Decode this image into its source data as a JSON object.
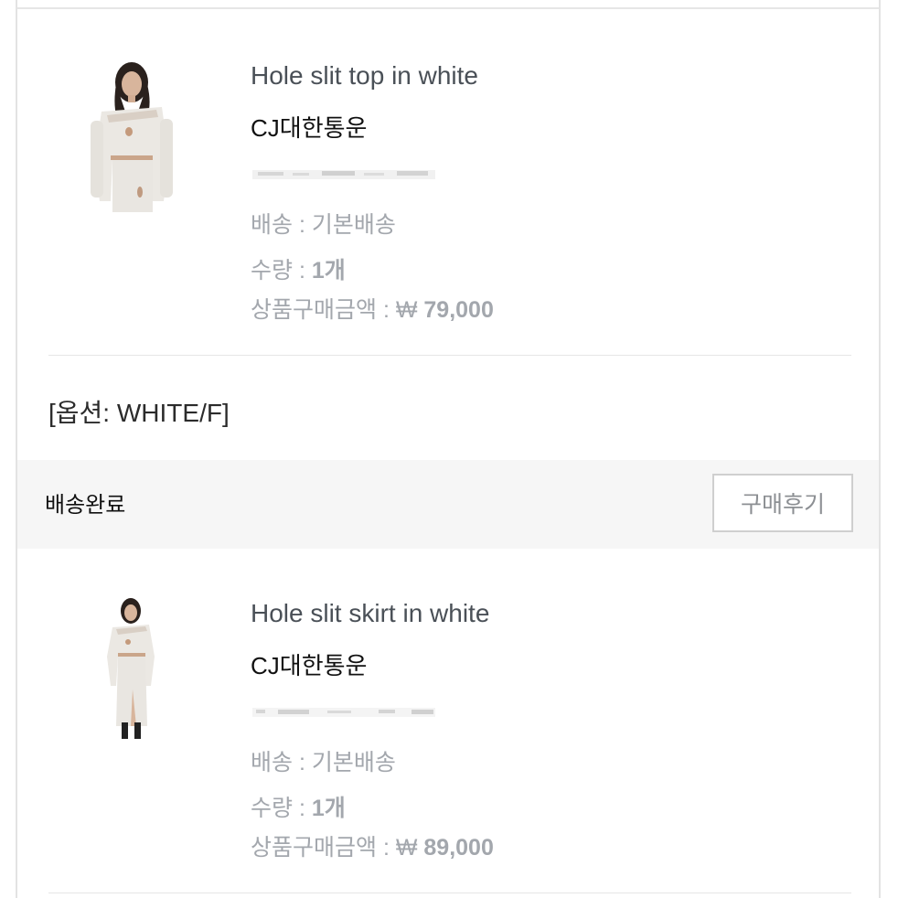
{
  "orders": [
    {
      "product_name": "Hole slit top in white",
      "carrier": "CJ대한통운",
      "shipping_line": "배송 : 기본배송",
      "quantity_label": "수량 : ",
      "quantity_value": "1개",
      "price_label": "상품구매금액 : ₩ ",
      "price_value": "79,000",
      "option": "[옵션: WHITE/F]"
    },
    {
      "product_name": "Hole slit skirt in white",
      "carrier": "CJ대한통운",
      "shipping_line": "배송 : 기본배송",
      "quantity_label": "수량 : ",
      "quantity_value": "1개",
      "price_label": "상품구매금액 : ₩ ",
      "price_value": "89,000"
    }
  ],
  "status_bar": {
    "status": "배송완료",
    "review_button": "구매후기"
  }
}
